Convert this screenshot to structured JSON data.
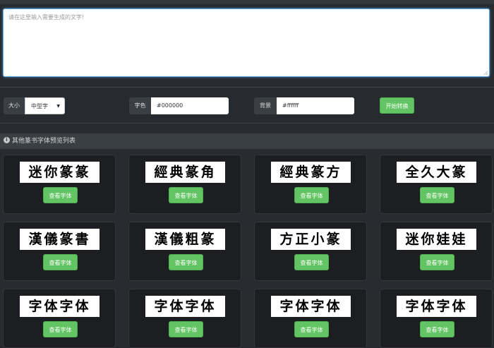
{
  "editor": {
    "placeholder": "请在这里输入需要生成的文字!"
  },
  "controls": {
    "size_label": "大小",
    "size_value": "中型字",
    "color_label": "字色",
    "color_value": "#000000",
    "bg_label": "背景",
    "bg_value": "#ffffff",
    "convert_button": "开始转换"
  },
  "section": {
    "title": "其他篆书字体预览列表"
  },
  "fonts": [
    {
      "sample": "迷你篆篆",
      "button": "查看字体"
    },
    {
      "sample": "經典篆角",
      "button": "查看字体"
    },
    {
      "sample": "經典篆方",
      "button": "查看字体"
    },
    {
      "sample": "全久大篆",
      "button": "查看字体"
    },
    {
      "sample": "漢儀篆書",
      "button": "查看字体"
    },
    {
      "sample": "漢儀粗篆",
      "button": "查看字体"
    },
    {
      "sample": "方正小篆",
      "button": "查看字体"
    },
    {
      "sample": "迷你娃娃",
      "button": "查看字体"
    },
    {
      "sample": "字体字体",
      "button": "查看字体"
    },
    {
      "sample": "字体字体",
      "button": "查看字体"
    },
    {
      "sample": "字体字体",
      "button": "查看字体"
    },
    {
      "sample": "字体字体",
      "button": "查看字体"
    }
  ]
}
